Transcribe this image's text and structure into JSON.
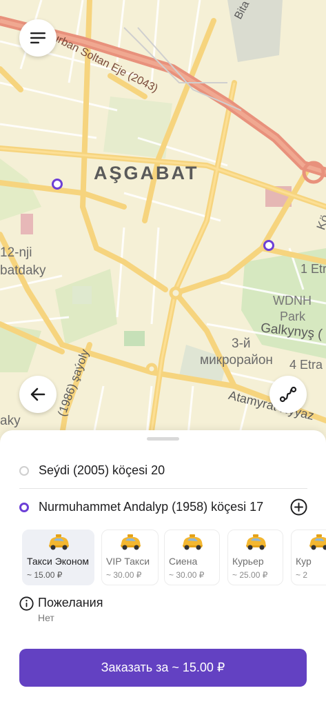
{
  "map": {
    "city_label": "AŞGABAT",
    "labels": {
      "gurban": "Gurban Soltan Eje (2043)",
      "bita": "Bita",
      "district_12": "12-nji",
      "batdaky": "batdaky",
      "wdnh": "WDNH",
      "park": "Park",
      "galkynys": "Galkynyş (",
      "district_3": "3-й",
      "mikro": "микрорайон",
      "etr4": "4 Etra",
      "etr1": "1 Etr",
      "k": "Kö",
      "atamyrat": "Atamyrat Nyýaz",
      "sayoly": "(1986) şaýoly",
      "aky": "aky"
    },
    "route_color": "#6c3fd6"
  },
  "buttons": {
    "menu_icon": "hamburger-icon",
    "back_icon": "arrow-left-icon",
    "route_icon": "route-icon"
  },
  "route": {
    "from": "Seýdi (2005) köçesi 20",
    "to": "Nurmuhammet Andalyp (1958) köçesi 17",
    "add_icon": "plus-circle-icon"
  },
  "tariffs": [
    {
      "name": "Такси Эконом",
      "price": "~ 15.00 ₽",
      "selected": true
    },
    {
      "name": "VIP Такси",
      "price": "~ 30.00 ₽",
      "selected": false
    },
    {
      "name": "Сиена",
      "price": "~ 30.00 ₽",
      "selected": false
    },
    {
      "name": "Курьер",
      "price": "~ 25.00 ₽",
      "selected": false
    },
    {
      "name": "Кур",
      "price": "~ 2",
      "selected": false
    }
  ],
  "wishes": {
    "title": "Пожелания",
    "value": "Нет",
    "icon": "info-icon"
  },
  "order_button": "Заказать за ~ 15.00 ₽",
  "colors": {
    "accent": "#6341c2",
    "selected_tariff_bg": "#eef0f5",
    "taxi_yellow": "#f3b731"
  }
}
